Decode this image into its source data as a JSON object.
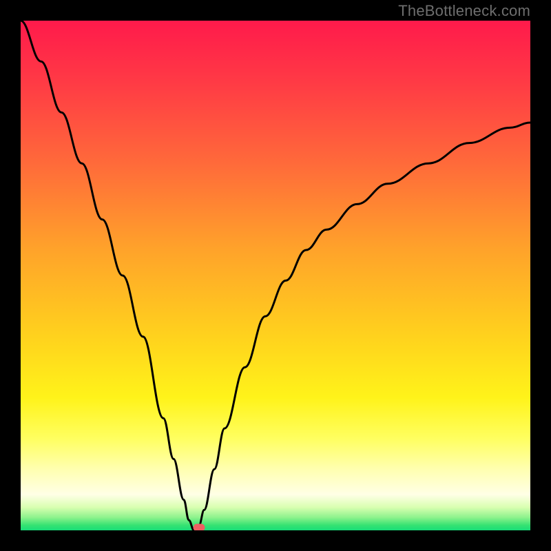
{
  "watermark": "TheBottleneck.com",
  "colors": {
    "frame": "#000000",
    "curve": "#000000",
    "marker": "#ed5f62",
    "gradient_stops": [
      {
        "offset": 0.0,
        "color": "#ff1a4b"
      },
      {
        "offset": 0.12,
        "color": "#ff3a45"
      },
      {
        "offset": 0.28,
        "color": "#ff6a3a"
      },
      {
        "offset": 0.45,
        "color": "#ffa32a"
      },
      {
        "offset": 0.62,
        "color": "#ffd21d"
      },
      {
        "offset": 0.74,
        "color": "#fff31a"
      },
      {
        "offset": 0.82,
        "color": "#ffff60"
      },
      {
        "offset": 0.88,
        "color": "#ffffb0"
      },
      {
        "offset": 0.93,
        "color": "#ffffe6"
      },
      {
        "offset": 0.955,
        "color": "#d8ffb0"
      },
      {
        "offset": 0.975,
        "color": "#8cf28c"
      },
      {
        "offset": 0.99,
        "color": "#35e372"
      },
      {
        "offset": 1.0,
        "color": "#18dd78"
      }
    ]
  },
  "chart_data": {
    "type": "line",
    "title": "",
    "xlabel": "",
    "ylabel": "",
    "xlim": [
      0,
      100
    ],
    "ylim": [
      0,
      100
    ],
    "note": "Values are approximate, read visually from the image. x runs left→right, y runs bottom→top (0 = bottom green band, 100 = top red).",
    "minimum_x": 34,
    "marker": {
      "x": 35,
      "y": 0.5
    },
    "series": [
      {
        "name": "bottleneck-curve",
        "x": [
          0,
          4,
          8,
          12,
          16,
          20,
          24,
          28,
          30,
          32,
          33,
          34,
          35,
          36,
          38,
          40,
          44,
          48,
          52,
          56,
          60,
          66,
          72,
          80,
          88,
          96,
          100
        ],
        "y": [
          100,
          92,
          82,
          72,
          61,
          50,
          38,
          22,
          14,
          6,
          2,
          0,
          1,
          4,
          12,
          20,
          32,
          42,
          49,
          55,
          59,
          64,
          68,
          72,
          76,
          79,
          80
        ]
      }
    ]
  }
}
